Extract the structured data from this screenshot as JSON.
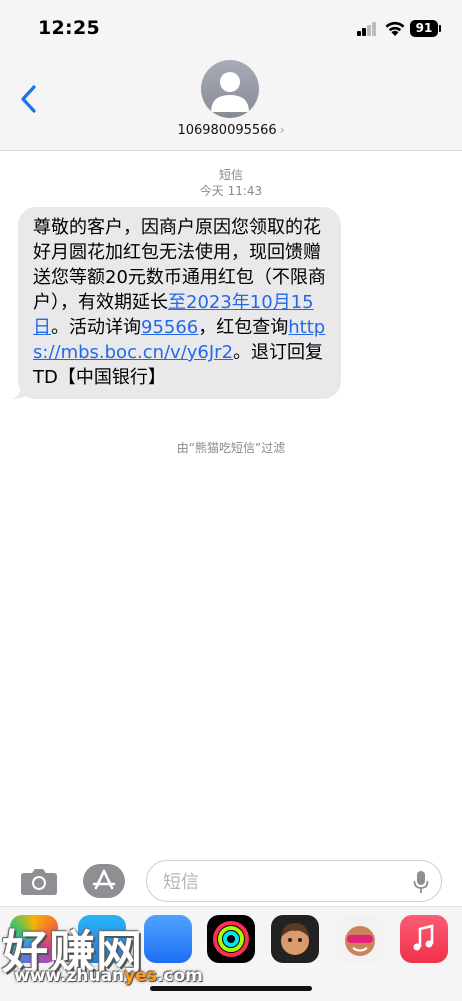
{
  "status_bar": {
    "time": "12:25",
    "battery": "91"
  },
  "header": {
    "back_icon": "chevron-left-icon",
    "contact_number": "106980095566",
    "contact_chevron": "›"
  },
  "thread": {
    "service_label": "短信",
    "timestamp": "今天 11:43",
    "message": {
      "part1": "尊敬的客户，因商户原因您领取的花好月圆花加红包无法使用，现回馈赠送您等额20元数币通用红包（不限商户），有效期延长",
      "link_date": "至2023年10月15日",
      "part2": "。活动详询",
      "link_phone": "95566",
      "part3": "，红包查询",
      "link_url": "https://mbs.boc.cn/v/y6Jr2",
      "part4": "。退订回复TD【中国银行】"
    },
    "filter_note": "由“熊猫吃短信”过滤"
  },
  "input_bar": {
    "camera_icon": "camera-icon",
    "apps_icon": "app-store-icon",
    "placeholder": "短信",
    "mic_icon": "microphone-icon"
  },
  "app_strip": {
    "apps": [
      "photos",
      "app-store",
      "apple-pay",
      "fitness",
      "memoji",
      "animoji",
      "music"
    ]
  },
  "watermark": {
    "brand": "好赚网",
    "url_prefix": "www.zhuan",
    "url_highlight": "yes",
    "url_suffix": ".com"
  },
  "colors": {
    "link": "#2469e8",
    "bubble": "#e9e9eb",
    "accent": "#1a73e8"
  }
}
